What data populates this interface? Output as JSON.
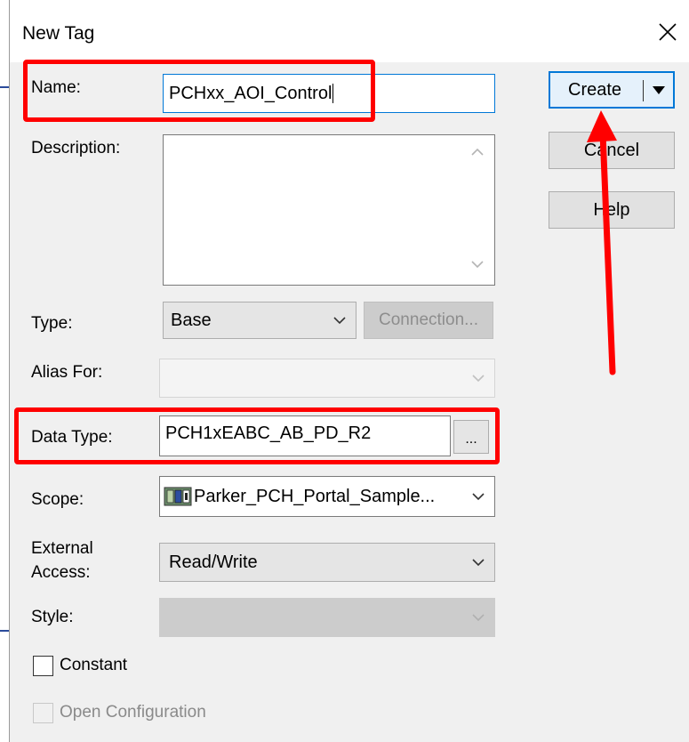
{
  "window": {
    "title": "New Tag",
    "close_icon": "close-icon"
  },
  "fields": {
    "name_label": "Name:",
    "name_value": "PCHxx_AOI_Control",
    "description_label": "Description:",
    "description_value": "",
    "type_label": "Type:",
    "type_value": "Base",
    "connection_button": "Connection...",
    "alias_label": "Alias For:",
    "alias_value": "",
    "data_type_label": "Data Type:",
    "data_type_value": "PCH1xEABC_AB_PD_R2",
    "data_type_browse": "...",
    "scope_label": "Scope:",
    "scope_value": "Parker_PCH_Portal_Sample...",
    "scope_icon": "controller-icon",
    "external_access_label_line1": "External",
    "external_access_label_line2": "Access:",
    "external_access_value": "Read/Write",
    "style_label": "Style:",
    "style_value": ""
  },
  "checkboxes": {
    "constant_label": "Constant",
    "constant_checked": false,
    "open_config_label": "Open Configuration",
    "open_config_checked": false
  },
  "buttons": {
    "create": "Create",
    "cancel": "Cancel",
    "help": "Help"
  },
  "annotations": {
    "highlight_color": "#ff0000",
    "arrow_color": "#ff0000"
  },
  "colors": {
    "focus_blue": "#0078d7",
    "dialog_bg": "#f0f0f0"
  }
}
